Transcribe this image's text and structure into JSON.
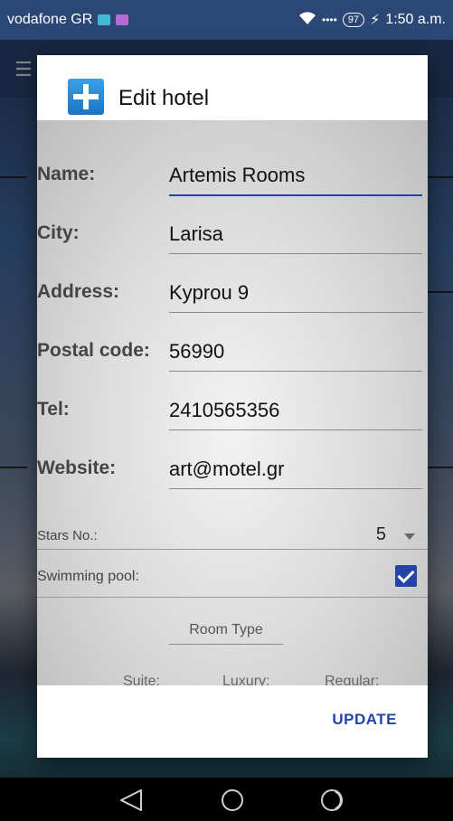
{
  "status_bar": {
    "carrier": "vodafone GR",
    "battery": "97",
    "time": "1:50 a.m."
  },
  "dialog": {
    "title": "Edit hotel",
    "fields": [
      {
        "label": "Name:",
        "value": "Artemis Rooms"
      },
      {
        "label": "City:",
        "value": "Larisa"
      },
      {
        "label": "Address:",
        "value": "Kyprou 9"
      },
      {
        "label": "Postal code:",
        "value": "56990"
      },
      {
        "label": "Tel:",
        "value": "2410565356"
      },
      {
        "label": "Website:",
        "value": "art@motel.gr"
      }
    ],
    "stars": {
      "label": "Stars No.:",
      "value": "5"
    },
    "pool": {
      "label": "Swimming pool:",
      "checked": true
    },
    "room_type": {
      "title": "Room Type",
      "columns": [
        "Suite:",
        "Luxury:",
        "Regular:"
      ]
    },
    "update_label": "UPDATE"
  },
  "colors": {
    "accent": "#2444a8",
    "status_bar": "#2a4775"
  }
}
